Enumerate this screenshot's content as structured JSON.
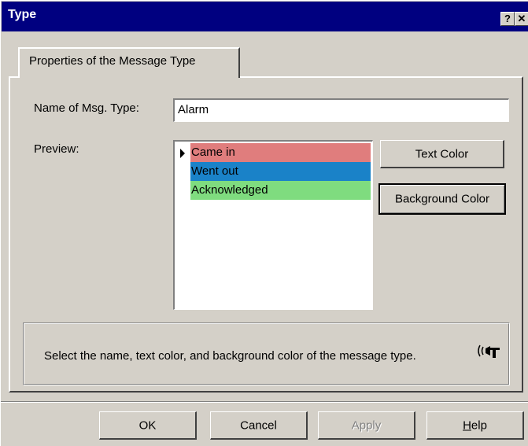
{
  "window": {
    "title": "Type",
    "help_button": "?",
    "close_button": "✕"
  },
  "tab": {
    "label": "Properties of the Message Type"
  },
  "form": {
    "name_label": "Name of Msg. Type:",
    "name_value": "Alarm",
    "preview_label": "Preview:"
  },
  "preview": {
    "items": [
      {
        "label": "Came in",
        "bg_color": "#e07d7d"
      },
      {
        "label": "Went out",
        "bg_color": "#1a82c8"
      },
      {
        "label": "Acknowledged",
        "bg_color": "#7fdc7f"
      }
    ]
  },
  "buttons": {
    "text_color": "Text Color",
    "background_color": "Background Color",
    "ok": "OK",
    "cancel": "Cancel",
    "apply": "Apply",
    "help_prefix": "",
    "help_mnemonic": "H",
    "help_rest": "elp"
  },
  "info": {
    "text": "Select the name, text color, and background color of the message type.",
    "icon": "horn-icon"
  },
  "colors": {
    "titlebar": "#000080",
    "face": "#d4d0c8"
  }
}
